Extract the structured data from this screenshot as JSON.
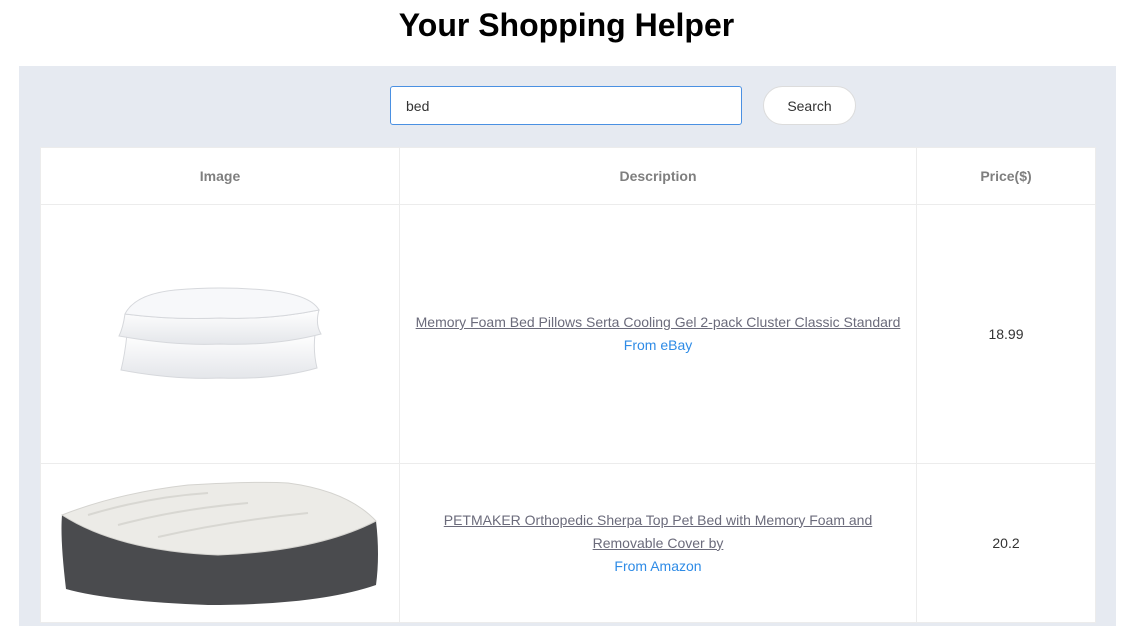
{
  "page": {
    "title": "Your Shopping Helper"
  },
  "search": {
    "value": "bed",
    "button_label": "Search"
  },
  "table": {
    "headers": [
      "Image",
      "Description",
      "Price($)"
    ],
    "rows": [
      {
        "description": "Memory Foam Bed Pillows Serta Cooling Gel 2-pack Cluster Classic Standard",
        "source": "From eBay",
        "price": "18.99",
        "image": "pillows-image"
      },
      {
        "description": "PETMAKER Orthopedic Sherpa Top Pet Bed with Memory Foam and Removable Cover by",
        "source": "From Amazon",
        "price": "20.2",
        "image": "pet-bed-image"
      }
    ]
  },
  "colors": {
    "panel_bg": "#e6eaf1",
    "link": "#6b6b7b",
    "source_link": "#2e8be6",
    "input_border": "#4a90e2"
  }
}
